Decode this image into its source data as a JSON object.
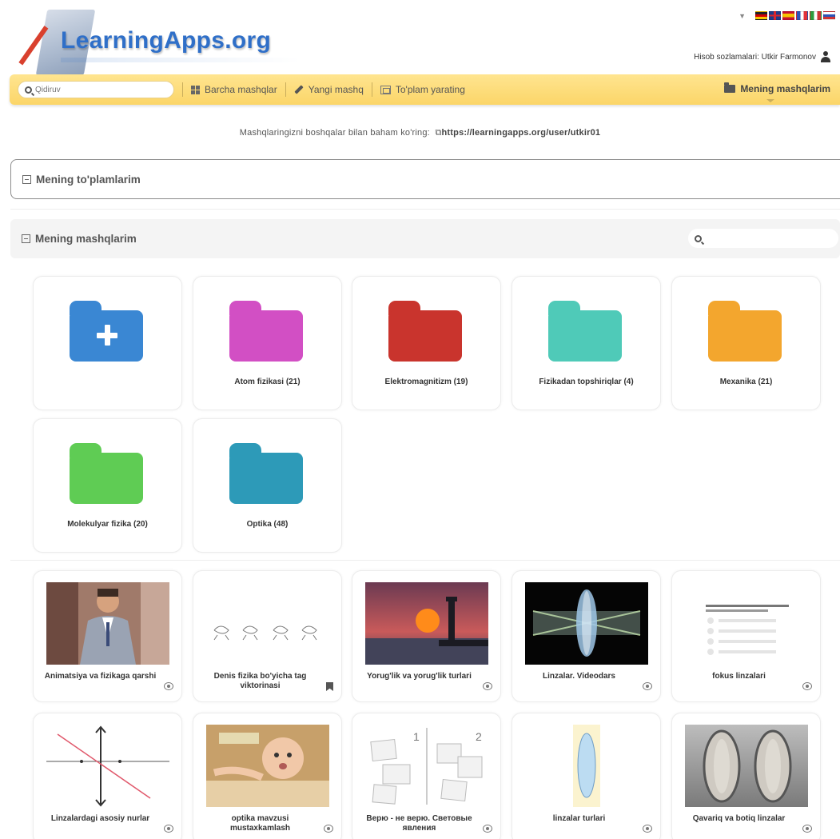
{
  "brand": {
    "logo_text": "LearningApps.org"
  },
  "languages": {
    "flags": [
      "#d40000",
      "#1f3c88",
      "#d9262c",
      "#2a55b8",
      "#2c9c3d",
      "#d03434"
    ]
  },
  "account": {
    "label": "Hisob sozlamalari: Utkir Farmonov"
  },
  "navbar": {
    "search_placeholder": "Qidiruv",
    "all_apps": "Barcha mashqlar",
    "new_app": "Yangi mashq",
    "create_collection": "To'plam yarating",
    "my_apps": "Mening mashqlarim"
  },
  "share": {
    "prefix": "Mashqlaringizni boshqalar bilan baham ko'ring:",
    "url": "https://learningapps.org/user/utkir01"
  },
  "sections": {
    "collections_title": "Mening to'plamlarim",
    "apps_title": "Mening mashqlarim"
  },
  "folders": [
    {
      "label": "",
      "color": "#3a87d3",
      "is_new": true
    },
    {
      "label": "Atom fizikasi (21)",
      "color": "#d24fc4"
    },
    {
      "label": "Elektromagnitizm (19)",
      "color": "#c9342d"
    },
    {
      "label": "Fizikadan topshiriqlar (4)",
      "color": "#4fcab8"
    },
    {
      "label": "Mexanika (21)",
      "color": "#f3a62e"
    },
    {
      "label": "Molekulyar fizika (20)",
      "color": "#5fcc54"
    },
    {
      "label": "Optika (48)",
      "color": "#2d9ab8"
    }
  ],
  "apps": [
    {
      "label": "Animatsiya va fizikaga qarshi",
      "icon": "eye-icon"
    },
    {
      "label": "Denis fizika bo'yicha tag viktorinasi",
      "icon": "bookmark-icon"
    },
    {
      "label": "Yorug'lik va yorug'lik turlari",
      "icon": "eye-icon"
    },
    {
      "label": "Linzalar. Videodars",
      "icon": "eye-icon"
    },
    {
      "label": "fokus linzalari",
      "icon": "eye-icon"
    },
    {
      "label": "Linzalardagi asosiy nurlar",
      "icon": "eye-icon"
    },
    {
      "label": "optika mavzusi mustaxkamlash",
      "icon": "eye-icon"
    },
    {
      "label": "Верю - не верю. Световые явления",
      "icon": "eye-icon",
      "thumb_numbers": [
        "1",
        "2"
      ]
    },
    {
      "label": "linzalar turlari",
      "icon": "eye-icon"
    },
    {
      "label": "Qavariq va botiq linzalar",
      "icon": "eye-icon"
    }
  ]
}
